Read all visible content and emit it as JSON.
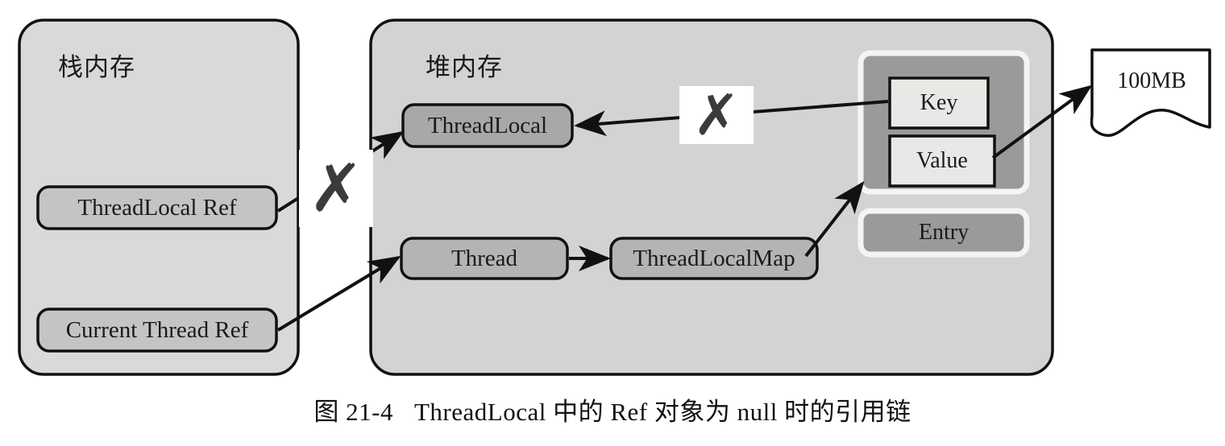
{
  "figure": {
    "caption_number": "图 21-4",
    "caption_text": "ThreadLocal 中的 Ref 对象为 null 时的引用链"
  },
  "regions": [
    {
      "id": "stack",
      "title": "栈内存",
      "fill": "#d9d9d7",
      "stroke": "#111111"
    },
    {
      "id": "heap",
      "title": "堆内存",
      "fill": "#d3d3d1",
      "stroke": "#111111"
    }
  ],
  "nodes": {
    "threadlocal_ref": {
      "label": "ThreadLocal Ref",
      "fill": "#c4c4c2",
      "stroke": "#111111"
    },
    "current_thread_ref": {
      "label": "Current Thread Ref",
      "fill": "#c4c4c2",
      "stroke": "#111111"
    },
    "threadlocal": {
      "label": "ThreadLocal",
      "fill": "#a8a8a6",
      "stroke": "#111111"
    },
    "thread": {
      "label": "Thread",
      "fill": "#b4b4b2",
      "stroke": "#111111"
    },
    "threadlocalmap": {
      "label": "ThreadLocalMap",
      "fill": "#b4b4b2",
      "stroke": "#111111"
    },
    "entry_kv_container": {
      "label": "",
      "fill": "#9a9a98",
      "stroke": "#f2f2f0"
    },
    "key": {
      "label": "Key",
      "fill": "#e6e6e4",
      "stroke": "#111111"
    },
    "value": {
      "label": "Value",
      "fill": "#e6e6e4",
      "stroke": "#111111"
    },
    "entry": {
      "label": "Entry",
      "fill": "#9a9a98",
      "stroke": "#f2f2f0"
    },
    "memory_blob": {
      "label": "100MB",
      "fill": "#ffffff",
      "stroke": "#111111"
    }
  },
  "markers": {
    "broken_ref_stack": {
      "glyph": "✗",
      "meaning": "broken-reference"
    },
    "broken_ref_heap": {
      "glyph": "✗",
      "meaning": "broken-reference"
    }
  },
  "edges": [
    {
      "id": "threadlocal-ref-to-threadlocal",
      "from": "threadlocal_ref",
      "to": "threadlocal",
      "broken": true
    },
    {
      "id": "current-thread-ref-to-thread",
      "from": "current_thread_ref",
      "to": "thread",
      "broken": false
    },
    {
      "id": "thread-to-threadlocalmap",
      "from": "thread",
      "to": "threadlocalmap",
      "broken": false
    },
    {
      "id": "threadlocalmap-to-entry",
      "from": "threadlocalmap",
      "to": "entry_kv_container",
      "broken": false
    },
    {
      "id": "key-to-threadlocal",
      "from": "key",
      "to": "threadlocal",
      "broken": true
    },
    {
      "id": "value-to-memory",
      "from": "value",
      "to": "memory_blob",
      "broken": false
    }
  ]
}
